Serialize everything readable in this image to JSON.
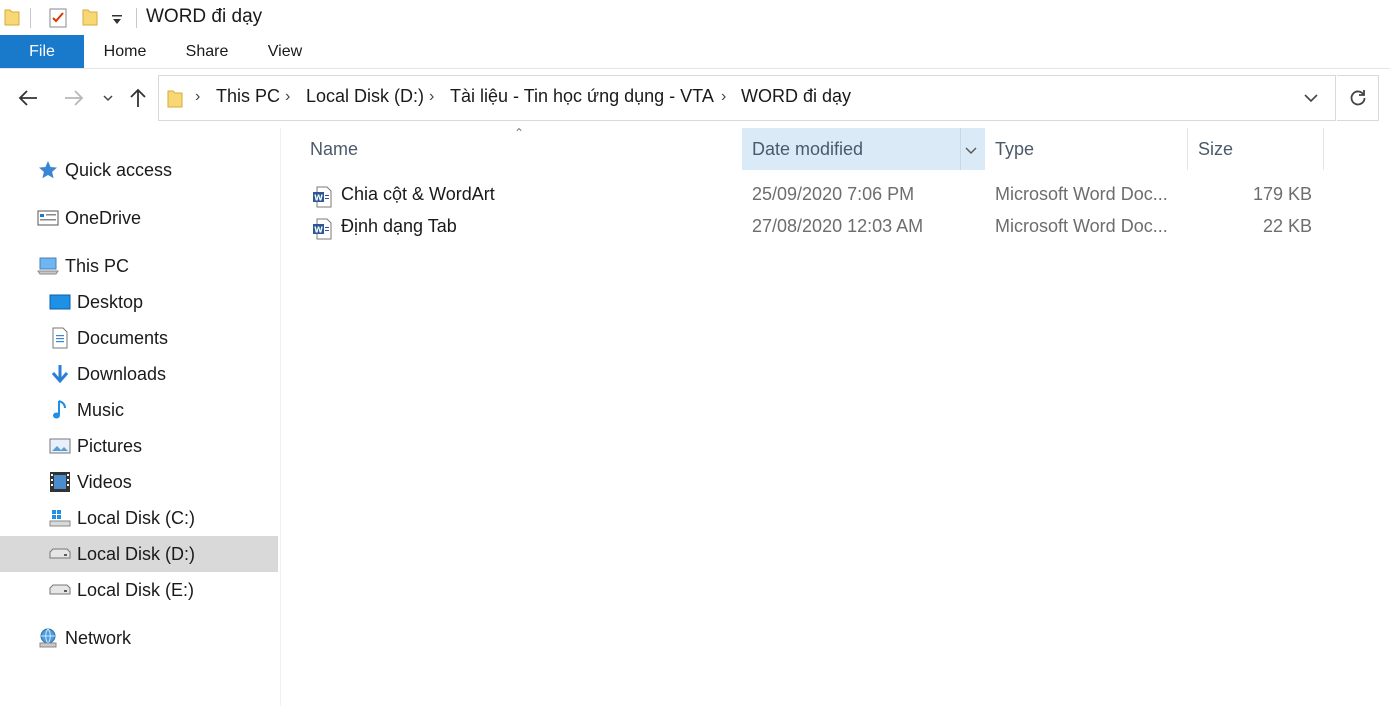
{
  "window": {
    "title": "WORD đi dạy"
  },
  "ribbon": {
    "tabs": [
      {
        "label": "File"
      },
      {
        "label": "Home"
      },
      {
        "label": "Share"
      },
      {
        "label": "View"
      }
    ]
  },
  "address": {
    "breadcrumbs": [
      {
        "label": "This PC"
      },
      {
        "label": "Local Disk (D:)"
      },
      {
        "label": "Tài liệu - Tin học ứng dụng - VTA"
      },
      {
        "label": "WORD đi dạy"
      }
    ]
  },
  "sidebar": {
    "items": [
      {
        "label": "Quick access",
        "icon": "star-icon"
      },
      {
        "label": "OneDrive",
        "icon": "onedrive-icon"
      },
      {
        "label": "This PC",
        "icon": "computer-icon"
      },
      {
        "label": "Desktop",
        "icon": "desktop-icon"
      },
      {
        "label": "Documents",
        "icon": "documents-icon"
      },
      {
        "label": "Downloads",
        "icon": "download-icon"
      },
      {
        "label": "Music",
        "icon": "music-icon"
      },
      {
        "label": "Pictures",
        "icon": "pictures-icon"
      },
      {
        "label": "Videos",
        "icon": "videos-icon"
      },
      {
        "label": "Local Disk (C:)",
        "icon": "windows-drive-icon"
      },
      {
        "label": "Local Disk (D:)",
        "icon": "drive-icon",
        "selected": true
      },
      {
        "label": "Local Disk (E:)",
        "icon": "drive-icon"
      },
      {
        "label": "Network",
        "icon": "network-icon"
      }
    ]
  },
  "filelist": {
    "columns": [
      {
        "label": "Name"
      },
      {
        "label": "Date modified"
      },
      {
        "label": "Type"
      },
      {
        "label": "Size"
      }
    ],
    "rows": [
      {
        "name": "Chia cột & WordArt",
        "date": "25/09/2020 7:06 PM",
        "type": "Microsoft Word Doc...",
        "size": "179 KB",
        "icon": "word-doc-icon"
      },
      {
        "name": "Định dạng Tab",
        "date": "27/08/2020 12:03 AM",
        "type": "Microsoft Word Doc...",
        "size": "22 KB",
        "icon": "word-doc-icon"
      }
    ]
  },
  "colors": {
    "accent": "#1979ca",
    "selected_column": "#dbeaf7",
    "selected_nav": "#d9d9d9",
    "folder": "#f8d775"
  }
}
